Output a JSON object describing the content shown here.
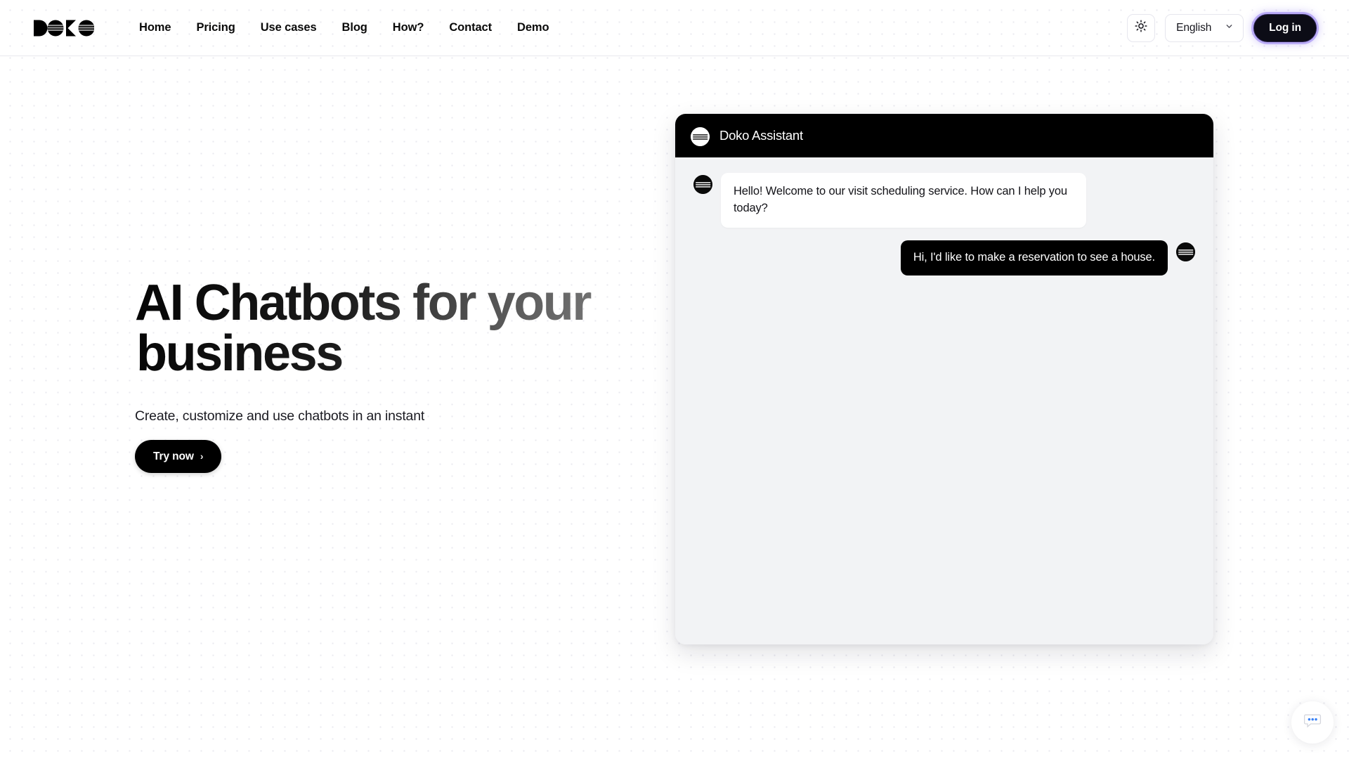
{
  "brand": {
    "name": "DOKO",
    "logo_icon": "doko-logo"
  },
  "header": {
    "nav": [
      {
        "label": "Home"
      },
      {
        "label": "Pricing"
      },
      {
        "label": "Use cases"
      },
      {
        "label": "Blog"
      },
      {
        "label": "How?"
      },
      {
        "label": "Contact"
      },
      {
        "label": "Demo"
      }
    ],
    "theme_toggle_icon": "sun-icon",
    "language": {
      "selected": "English",
      "chevron_icon": "chevron-down-icon"
    },
    "login_label": "Log in",
    "login_glow_color": "#937df0",
    "login_bg_color": "#0c0c16"
  },
  "hero": {
    "title_line1": "AI Chatbots for your",
    "title_line2": "business",
    "subtitle": "Create, customize and use chatbots in an instant",
    "cta_label": "Try now",
    "cta_chevron": "›"
  },
  "chat_widget": {
    "header": {
      "title": "Doko Assistant",
      "avatar_icon": "doko-avatar-light"
    },
    "messages": [
      {
        "sender": "bot",
        "text": "Hello! Welcome to our visit scheduling service. How can I help you today?",
        "avatar_icon": "doko-avatar-dark"
      },
      {
        "sender": "user",
        "text": "Hi, I'd like to make a reservation to see a house.",
        "avatar_icon": "doko-avatar-dark"
      }
    ]
  },
  "chat_launcher": {
    "icon": "chat-bubble-icon",
    "dot_color": "#3b82f6"
  },
  "colors": {
    "background": "#ffffff",
    "dot_grid": "#e9e9ef",
    "chat_panel_bg": "#f2f3f5",
    "chat_header_bg": "#000000",
    "text_primary": "#111111"
  }
}
